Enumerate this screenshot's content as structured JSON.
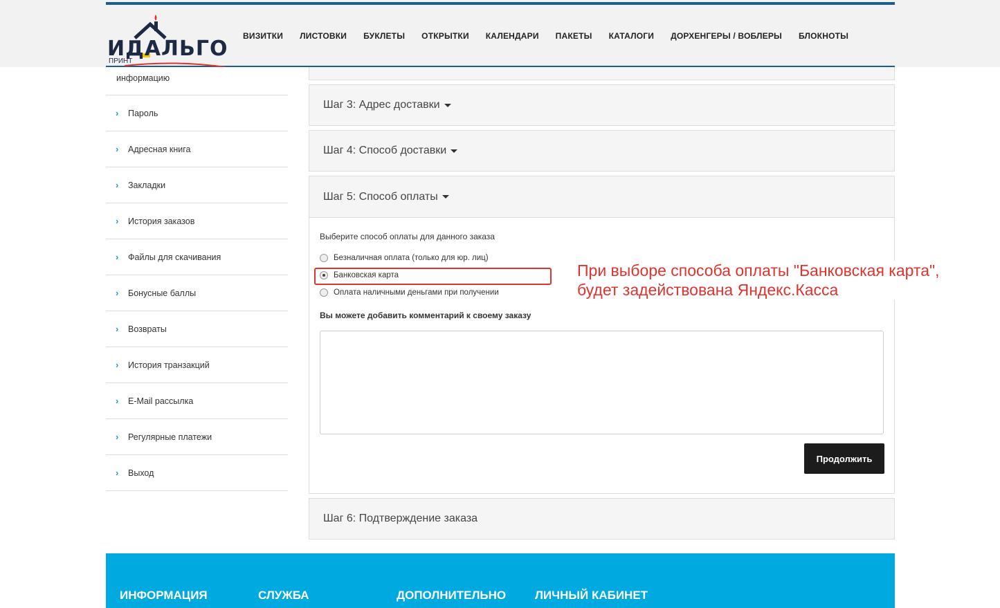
{
  "logo": {
    "brand_text": "ИДАЛЬГО",
    "sub_text": "ПРИНТ"
  },
  "nav": [
    "ВИЗИТКИ",
    "ЛИСТОВКИ",
    "БУКЛЕТЫ",
    "ОТКРЫТКИ",
    "КАЛЕНДАРИ",
    "ПАКЕТЫ",
    "КАТАЛОГИ",
    "ДОРХЕНГЕРЫ / ВОБЛЕРЫ",
    "БЛОКНОТЫ"
  ],
  "sidebar": {
    "first": "информацию",
    "items": [
      "Пароль",
      "Адресная книга",
      "Закладки",
      "История заказов",
      "Файлы для скачивания",
      "Бонусные баллы",
      "Возвраты",
      "История транзакций",
      "E-Mail рассылка",
      "Регулярные платежи",
      "Выход"
    ]
  },
  "steps": {
    "step3": "Шаг 3: Адрес доставки",
    "step4": "Шаг 4: Способ доставки",
    "step5": "Шаг 5: Способ оплаты",
    "step6": "Шаг 6: Подтверждение заказа"
  },
  "payment": {
    "title": "Выберите способ оплаты для данного заказа",
    "options": [
      {
        "label": "Безналичная оплата (только для юр. лиц)",
        "checked": false
      },
      {
        "label": "Банковская карта",
        "checked": true
      },
      {
        "label": "Оплата наличными деньгами при получении",
        "checked": false
      }
    ],
    "comment_label": "Вы можете добавить комментарий к своему заказу",
    "comment_value": "",
    "continue_label": "Продолжить"
  },
  "annotation": {
    "line1": "При выборе способа оплаты \"Банковская карта\",",
    "line2": "будет задействована Яндекс.Касса"
  },
  "footer": [
    "ИНФОРМАЦИЯ",
    "СЛУЖБА",
    "ДОПОЛНИТЕЛЬНО",
    "ЛИЧНЫЙ КАБИНЕТ"
  ],
  "colors": {
    "header_rule": "#1e5a96",
    "accent": "#1a9ad6",
    "footer": "#00a9e0",
    "annotation": "#e0332e"
  }
}
